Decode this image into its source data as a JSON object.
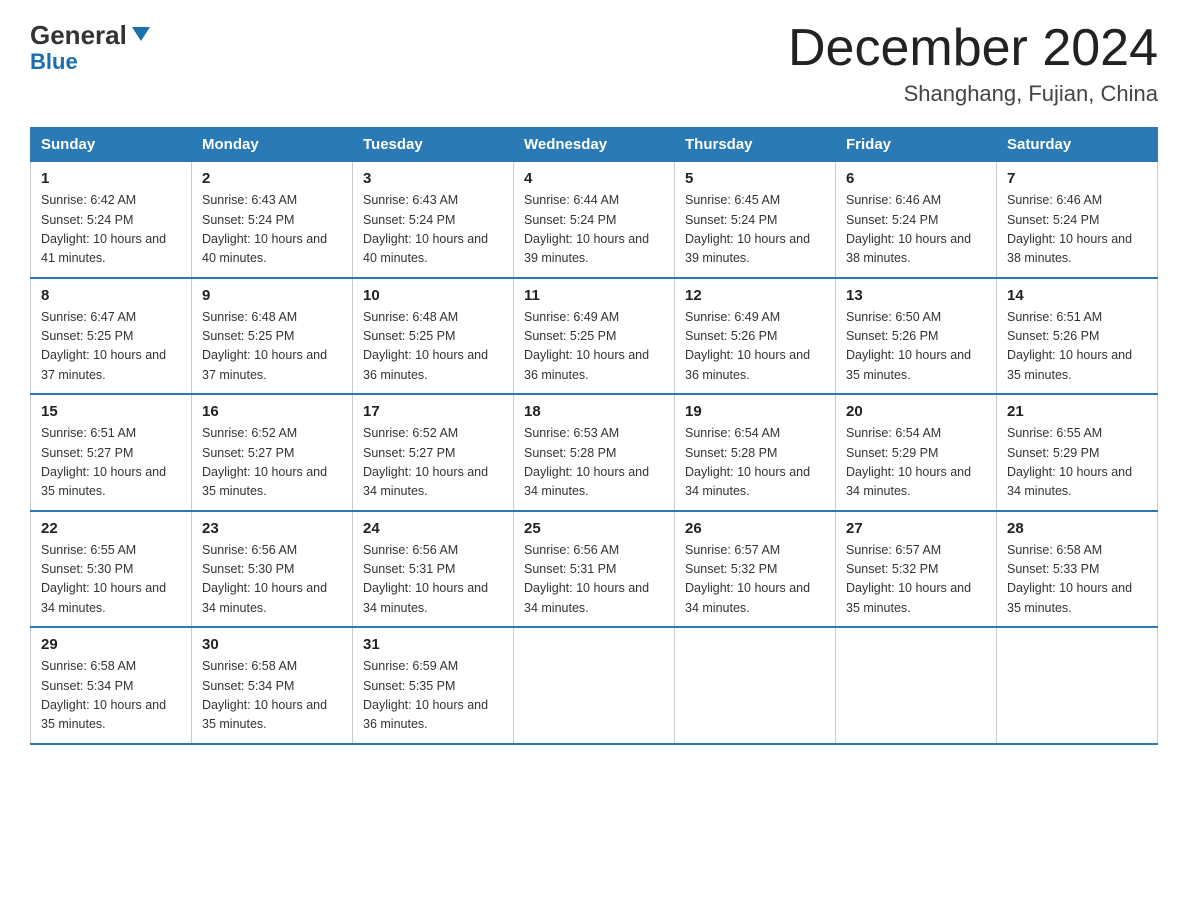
{
  "header": {
    "logo_general": "General",
    "logo_blue": "Blue",
    "title": "December 2024",
    "subtitle": "Shanghang, Fujian, China"
  },
  "days_of_week": [
    "Sunday",
    "Monday",
    "Tuesday",
    "Wednesday",
    "Thursday",
    "Friday",
    "Saturday"
  ],
  "weeks": [
    [
      {
        "day": "1",
        "sunrise": "6:42 AM",
        "sunset": "5:24 PM",
        "daylight": "10 hours and 41 minutes."
      },
      {
        "day": "2",
        "sunrise": "6:43 AM",
        "sunset": "5:24 PM",
        "daylight": "10 hours and 40 minutes."
      },
      {
        "day": "3",
        "sunrise": "6:43 AM",
        "sunset": "5:24 PM",
        "daylight": "10 hours and 40 minutes."
      },
      {
        "day": "4",
        "sunrise": "6:44 AM",
        "sunset": "5:24 PM",
        "daylight": "10 hours and 39 minutes."
      },
      {
        "day": "5",
        "sunrise": "6:45 AM",
        "sunset": "5:24 PM",
        "daylight": "10 hours and 39 minutes."
      },
      {
        "day": "6",
        "sunrise": "6:46 AM",
        "sunset": "5:24 PM",
        "daylight": "10 hours and 38 minutes."
      },
      {
        "day": "7",
        "sunrise": "6:46 AM",
        "sunset": "5:24 PM",
        "daylight": "10 hours and 38 minutes."
      }
    ],
    [
      {
        "day": "8",
        "sunrise": "6:47 AM",
        "sunset": "5:25 PM",
        "daylight": "10 hours and 37 minutes."
      },
      {
        "day": "9",
        "sunrise": "6:48 AM",
        "sunset": "5:25 PM",
        "daylight": "10 hours and 37 minutes."
      },
      {
        "day": "10",
        "sunrise": "6:48 AM",
        "sunset": "5:25 PM",
        "daylight": "10 hours and 36 minutes."
      },
      {
        "day": "11",
        "sunrise": "6:49 AM",
        "sunset": "5:25 PM",
        "daylight": "10 hours and 36 minutes."
      },
      {
        "day": "12",
        "sunrise": "6:49 AM",
        "sunset": "5:26 PM",
        "daylight": "10 hours and 36 minutes."
      },
      {
        "day": "13",
        "sunrise": "6:50 AM",
        "sunset": "5:26 PM",
        "daylight": "10 hours and 35 minutes."
      },
      {
        "day": "14",
        "sunrise": "6:51 AM",
        "sunset": "5:26 PM",
        "daylight": "10 hours and 35 minutes."
      }
    ],
    [
      {
        "day": "15",
        "sunrise": "6:51 AM",
        "sunset": "5:27 PM",
        "daylight": "10 hours and 35 minutes."
      },
      {
        "day": "16",
        "sunrise": "6:52 AM",
        "sunset": "5:27 PM",
        "daylight": "10 hours and 35 minutes."
      },
      {
        "day": "17",
        "sunrise": "6:52 AM",
        "sunset": "5:27 PM",
        "daylight": "10 hours and 34 minutes."
      },
      {
        "day": "18",
        "sunrise": "6:53 AM",
        "sunset": "5:28 PM",
        "daylight": "10 hours and 34 minutes."
      },
      {
        "day": "19",
        "sunrise": "6:54 AM",
        "sunset": "5:28 PM",
        "daylight": "10 hours and 34 minutes."
      },
      {
        "day": "20",
        "sunrise": "6:54 AM",
        "sunset": "5:29 PM",
        "daylight": "10 hours and 34 minutes."
      },
      {
        "day": "21",
        "sunrise": "6:55 AM",
        "sunset": "5:29 PM",
        "daylight": "10 hours and 34 minutes."
      }
    ],
    [
      {
        "day": "22",
        "sunrise": "6:55 AM",
        "sunset": "5:30 PM",
        "daylight": "10 hours and 34 minutes."
      },
      {
        "day": "23",
        "sunrise": "6:56 AM",
        "sunset": "5:30 PM",
        "daylight": "10 hours and 34 minutes."
      },
      {
        "day": "24",
        "sunrise": "6:56 AM",
        "sunset": "5:31 PM",
        "daylight": "10 hours and 34 minutes."
      },
      {
        "day": "25",
        "sunrise": "6:56 AM",
        "sunset": "5:31 PM",
        "daylight": "10 hours and 34 minutes."
      },
      {
        "day": "26",
        "sunrise": "6:57 AM",
        "sunset": "5:32 PM",
        "daylight": "10 hours and 34 minutes."
      },
      {
        "day": "27",
        "sunrise": "6:57 AM",
        "sunset": "5:32 PM",
        "daylight": "10 hours and 35 minutes."
      },
      {
        "day": "28",
        "sunrise": "6:58 AM",
        "sunset": "5:33 PM",
        "daylight": "10 hours and 35 minutes."
      }
    ],
    [
      {
        "day": "29",
        "sunrise": "6:58 AM",
        "sunset": "5:34 PM",
        "daylight": "10 hours and 35 minutes."
      },
      {
        "day": "30",
        "sunrise": "6:58 AM",
        "sunset": "5:34 PM",
        "daylight": "10 hours and 35 minutes."
      },
      {
        "day": "31",
        "sunrise": "6:59 AM",
        "sunset": "5:35 PM",
        "daylight": "10 hours and 36 minutes."
      },
      null,
      null,
      null,
      null
    ]
  ]
}
